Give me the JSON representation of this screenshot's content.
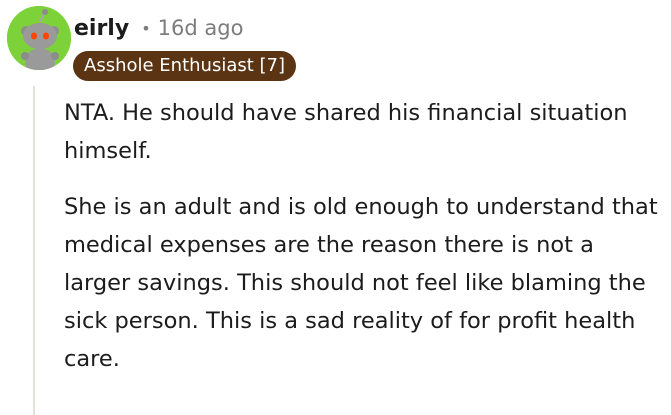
{
  "comment": {
    "author": "eirly",
    "separator": "•",
    "timestamp": "16d ago",
    "flair": "Asshole Enthusiast [7]",
    "avatar_icon": "snoo-avatar-icon",
    "paragraphs": [
      "NTA. He should have shared his financial situation himself.",
      "She is an adult and is old enough to understand that medical expenses are the reason there is not a larger savings. This should not feel like blaming the sick person. This is a sad reality of for profit health care."
    ]
  },
  "colors": {
    "avatar_background": "#7dd23a",
    "flair_background": "#5b3513",
    "flair_text": "#ffffff",
    "meta_text": "#7c7c7c",
    "thread_line": "#e4e0dc"
  }
}
